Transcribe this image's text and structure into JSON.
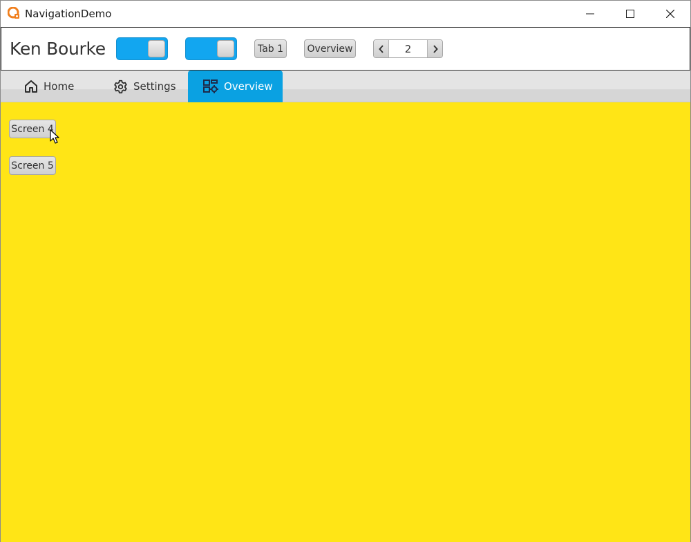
{
  "window": {
    "title": "NavigationDemo",
    "icon": "app-logo-icon",
    "controls": [
      "minimize-icon",
      "maximize-icon",
      "close-icon"
    ]
  },
  "toolbar": {
    "user_name": "Ken Bourke",
    "toggles": [
      {
        "state": "on",
        "color": "#12a6f0"
      },
      {
        "state": "on",
        "color": "#12a6f0"
      }
    ],
    "tab1_label": "Tab 1",
    "overview_label": "Overview",
    "pager": {
      "value": "2"
    }
  },
  "tabs": [
    {
      "label": "Home",
      "icon": "home-icon",
      "selected": false
    },
    {
      "label": "Settings",
      "icon": "gear-icon",
      "selected": false
    },
    {
      "label": "Overview",
      "icon": "dashboard-icon",
      "selected": true
    }
  ],
  "content": {
    "background": "#ffe516",
    "buttons": [
      {
        "label": "Screen 4"
      },
      {
        "label": "Screen 5"
      }
    ]
  },
  "colors": {
    "accent": "#0aa1e2",
    "content_bg": "#ffe516"
  }
}
